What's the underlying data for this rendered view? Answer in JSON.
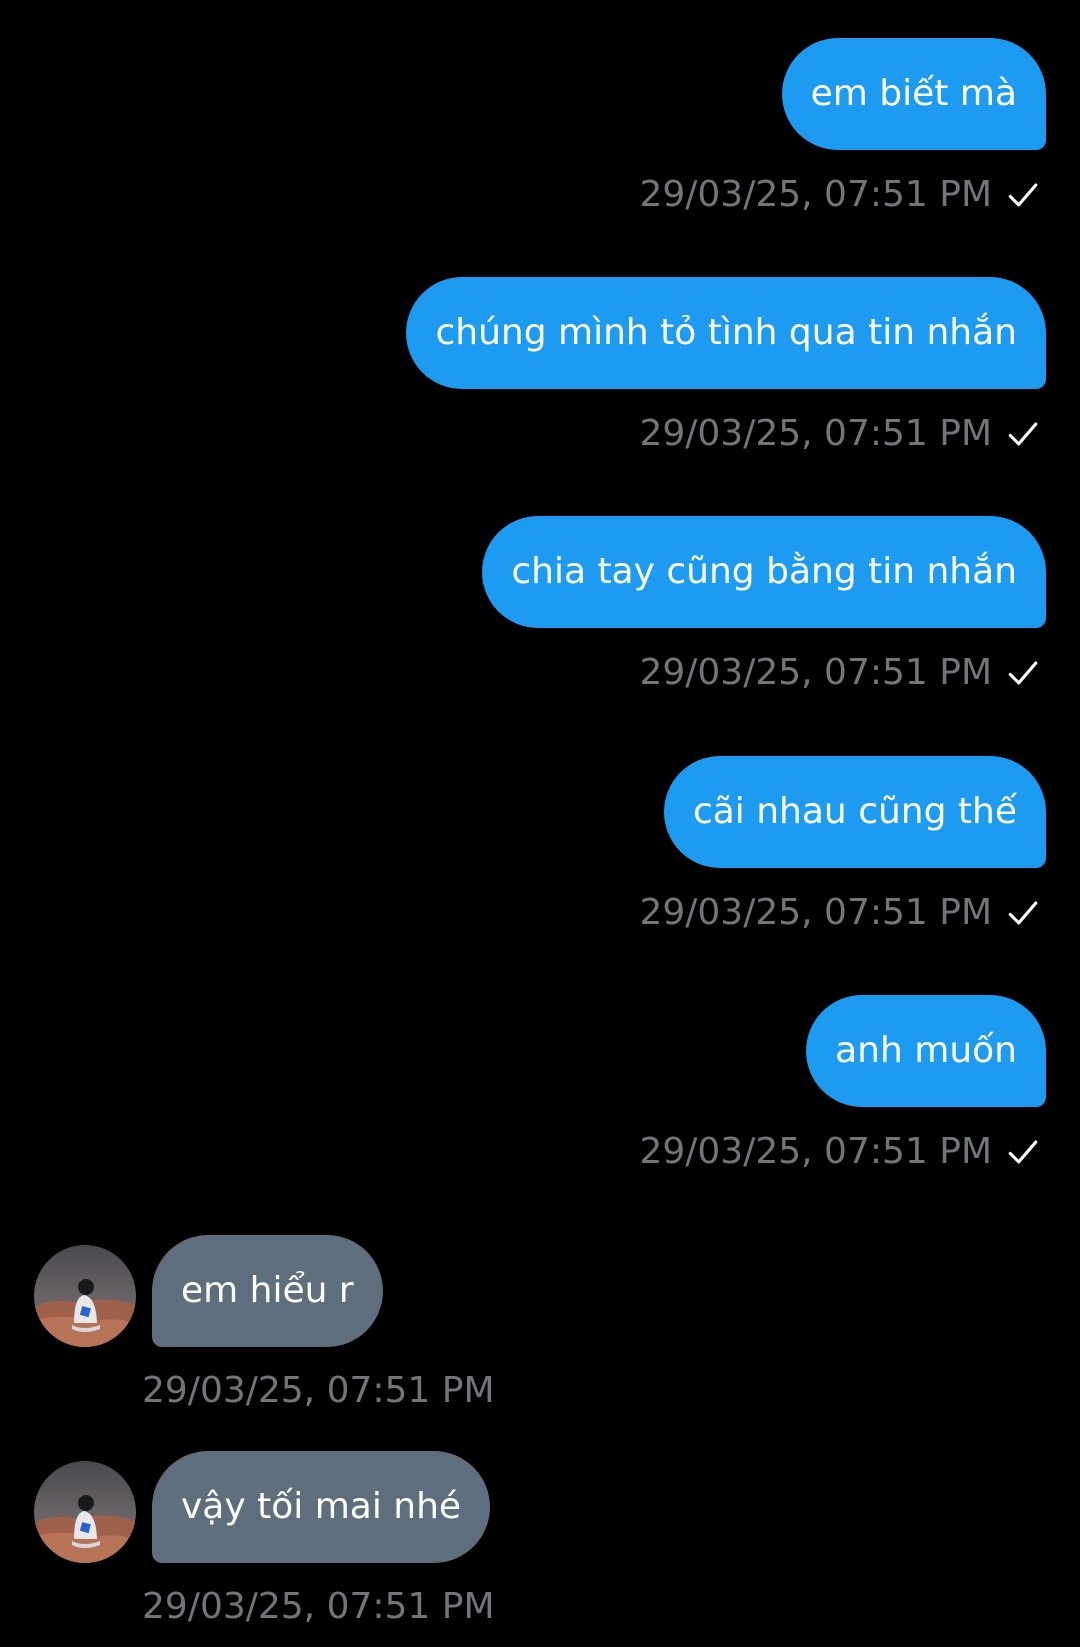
{
  "colors": {
    "background": "#000000",
    "outgoing_bubble": "#1d9bf0",
    "incoming_bubble": "#5f6e7c",
    "timestamp": "#71767b",
    "text": "#ffffff"
  },
  "messages": [
    {
      "direction": "out",
      "text": "em biết mà",
      "time": "29/03/25, 07:51 PM",
      "status_icon": "check-icon"
    },
    {
      "direction": "out",
      "text": "chúng mình tỏ tình qua tin nhắn",
      "time": "29/03/25, 07:51 PM",
      "status_icon": "check-icon"
    },
    {
      "direction": "out",
      "text": "chia tay cũng bằng tin nhắn",
      "time": "29/03/25, 07:51 PM",
      "status_icon": "check-icon"
    },
    {
      "direction": "out",
      "text": "cãi nhau cũng thế",
      "time": "29/03/25, 07:51 PM",
      "status_icon": "check-icon"
    },
    {
      "direction": "out",
      "text": "anh muốn",
      "time": "29/03/25, 07:51 PM",
      "status_icon": "check-icon"
    },
    {
      "direction": "in",
      "text": "em hiểu r",
      "time": "29/03/25, 07:51 PM",
      "avatar": "avatar-icon"
    },
    {
      "direction": "in",
      "text": "vậy tối mai nhé",
      "time": "29/03/25, 07:51 PM",
      "avatar": "avatar-icon"
    }
  ]
}
